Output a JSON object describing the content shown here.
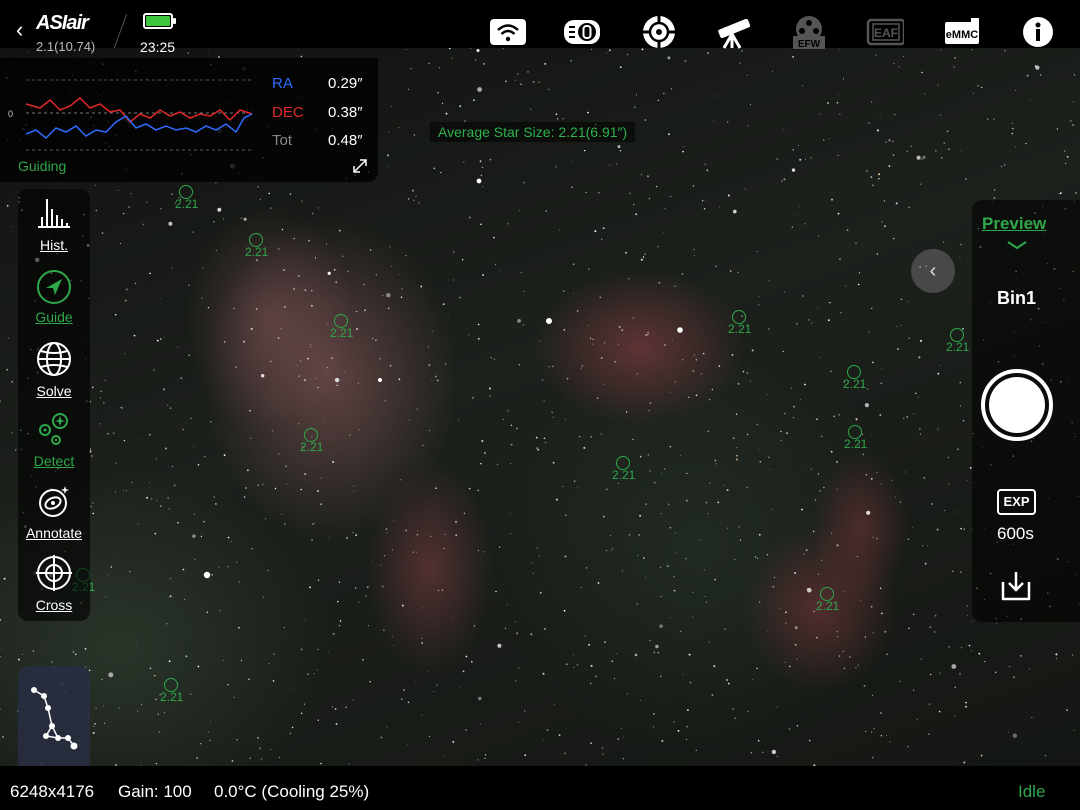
{
  "header": {
    "app_name": "ASIair",
    "version": "2.1(10.74)",
    "time": "23:25",
    "icons": [
      "wifi-icon",
      "camera-icon",
      "mount-icon",
      "telescope-icon",
      "efw-icon",
      "eaf-icon",
      "emmc-icon",
      "info-icon"
    ],
    "efw_label": "EFW",
    "eaf_label": "EAF",
    "emmc_label": "eMMC"
  },
  "guiding": {
    "ra_label": "RA",
    "dec_label": "DEC",
    "tot_label": "Tot",
    "ra_value": "0.29″",
    "dec_value": "0.38″",
    "tot_value": "0.48″",
    "zero_label": "0",
    "title": "Guiding",
    "colors": {
      "ra": "#2f6bff",
      "dec": "#e0282b",
      "tot": "#888888"
    }
  },
  "overlay": {
    "average_star_size": "Average Star Size: 2.21(6.91″)",
    "star_value": "2.21"
  },
  "left_tools": [
    {
      "label": "Hist.",
      "icon": "histogram-icon",
      "active": false
    },
    {
      "label": "Guide",
      "icon": "guide-icon",
      "active": true
    },
    {
      "label": "Solve",
      "icon": "globe-icon",
      "active": false
    },
    {
      "label": "Detect",
      "icon": "detect-icon",
      "active": true
    },
    {
      "label": "Annotate",
      "icon": "annotate-icon",
      "active": false
    },
    {
      "label": "Cross",
      "icon": "crosshair-icon",
      "active": false
    }
  ],
  "right_panel": {
    "mode": "Preview",
    "bin": "Bin1",
    "exp_label": "EXP",
    "exposure": "600s"
  },
  "status": {
    "resolution": "6248x4176",
    "gain": "Gain: 100",
    "temperature": "0.0°C (Cooling 25%)",
    "state": "Idle",
    "state_color": "#2ea84a"
  },
  "accent_color": "#2ea84a"
}
